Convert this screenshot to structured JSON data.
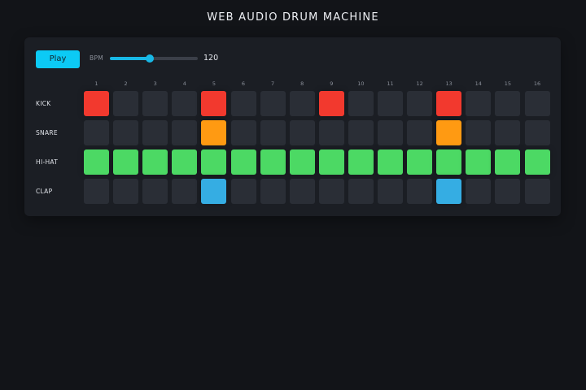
{
  "app": {
    "title": "WEB AUDIO DRUM MACHINE"
  },
  "transport": {
    "play_label": "Play",
    "bpm_label": "BPM",
    "bpm_value": "120",
    "bpm_slider_fraction": 0.45
  },
  "steps": [
    "1",
    "2",
    "3",
    "4",
    "5",
    "6",
    "7",
    "8",
    "9",
    "10",
    "11",
    "12",
    "13",
    "14",
    "15",
    "16"
  ],
  "colors": {
    "pad_off": "#2a2e36",
    "accent": "#0ccaf5"
  },
  "tracks": [
    {
      "label": "KICK",
      "color": "#f2392e",
      "pattern": [
        1,
        0,
        0,
        0,
        1,
        0,
        0,
        0,
        1,
        0,
        0,
        0,
        1,
        0,
        0,
        0
      ]
    },
    {
      "label": "SNARE",
      "color": "#ff9a12",
      "pattern": [
        0,
        0,
        0,
        0,
        1,
        0,
        0,
        0,
        0,
        0,
        0,
        0,
        1,
        0,
        0,
        0
      ]
    },
    {
      "label": "HI-HAT",
      "color": "#4cd964",
      "pattern": [
        1,
        1,
        1,
        1,
        1,
        1,
        1,
        1,
        1,
        1,
        1,
        1,
        1,
        1,
        1,
        1
      ]
    },
    {
      "label": "CLAP",
      "color": "#35ade3",
      "pattern": [
        0,
        0,
        0,
        0,
        1,
        0,
        0,
        0,
        0,
        0,
        0,
        0,
        1,
        0,
        0,
        0
      ]
    }
  ]
}
